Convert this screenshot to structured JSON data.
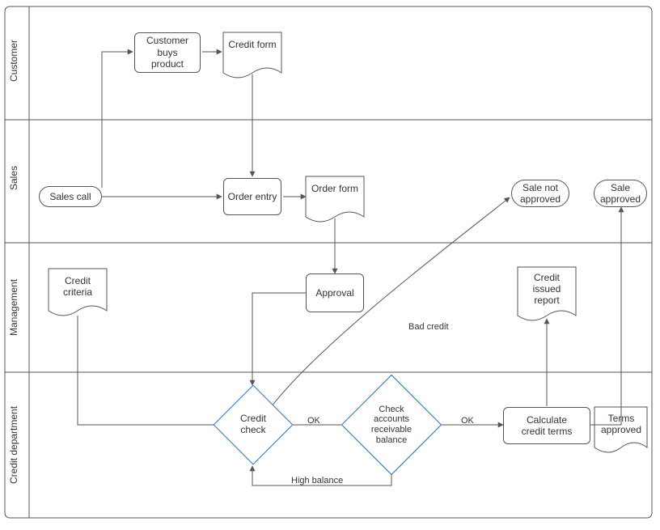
{
  "swimlanes": {
    "customer": {
      "label": "Customer"
    },
    "sales": {
      "label": "Sales"
    },
    "management": {
      "label": "Management"
    },
    "credit_dept": {
      "label": "Credit department"
    }
  },
  "nodes": {
    "sales_call": "Sales call",
    "customer_buys": "Customer\nbuys\nproduct",
    "credit_form": "Credit form",
    "order_entry": "Order entry",
    "order_form": "Order form",
    "sale_not_approved": "Sale not\napproved",
    "sale_approved": "Sale\napproved",
    "credit_criteria": "Credit\ncriteria",
    "approval": "Approval",
    "credit_issued_report": "Credit\nissued\nreport",
    "credit_check": "Credit\ncheck",
    "check_ar_balance": "Check\naccounts\nreceivable\nbalance",
    "calculate_terms": "Calculate\ncredit terms",
    "terms_approved": "Terms\napproved"
  },
  "edge_labels": {
    "bad_credit": "Bad credit",
    "ok1": "OK",
    "ok2": "OK",
    "high_balance": "High balance"
  }
}
